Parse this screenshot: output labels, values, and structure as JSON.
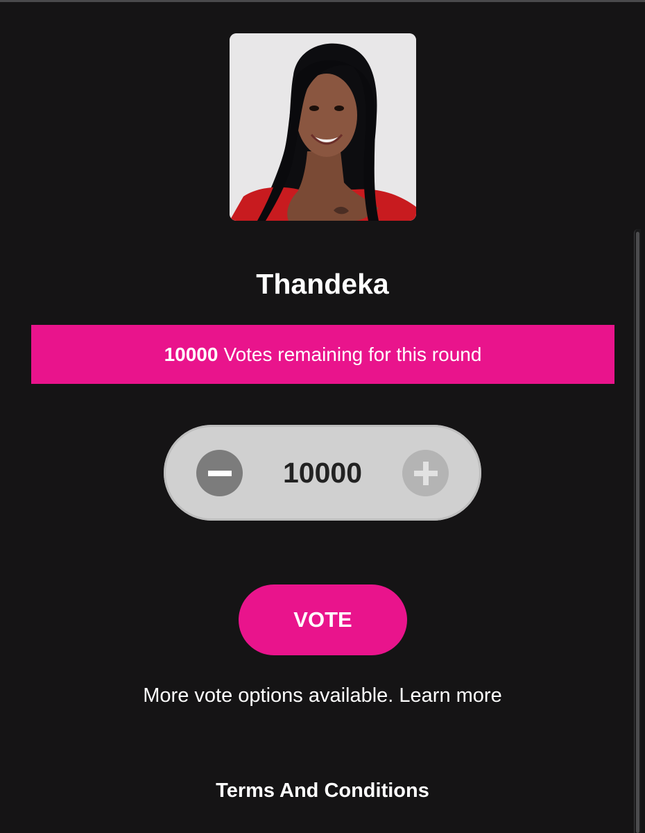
{
  "contestant": {
    "name": "Thandeka",
    "photo_alt": "contestant-portrait"
  },
  "banner": {
    "count": "10000",
    "text": "Votes remaining for this round"
  },
  "stepper": {
    "value": "10000",
    "minus_icon": "minus-icon",
    "plus_icon": "plus-icon"
  },
  "vote_button": {
    "label": "VOTE"
  },
  "more_options": {
    "text": "More vote options available.",
    "link": "Learn more"
  },
  "footer": {
    "terms": "Terms And Conditions"
  },
  "colors": {
    "background": "#151415",
    "accent": "#e9148c",
    "stepper_bg": "#d0d0d0"
  }
}
